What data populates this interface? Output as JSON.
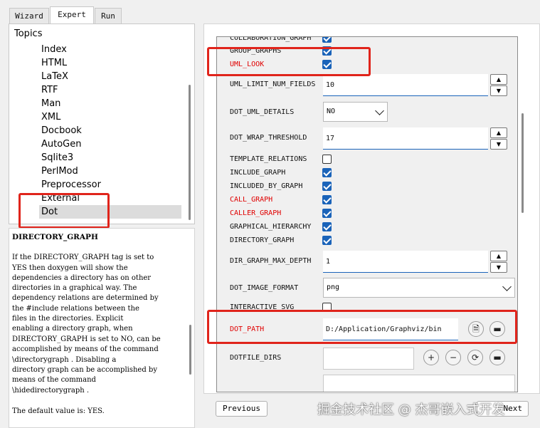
{
  "tabs": [
    {
      "label": "Wizard"
    },
    {
      "label": "Expert"
    },
    {
      "label": "Run"
    }
  ],
  "topics": {
    "title": "Topics",
    "items": [
      "Index",
      "HTML",
      "LaTeX",
      "RTF",
      "Man",
      "XML",
      "Docbook",
      "AutoGen",
      "Sqlite3",
      "PerlMod",
      "Preprocessor",
      "External",
      "Dot"
    ],
    "selected": "Dot"
  },
  "help": {
    "title": "DIRECTORY_GRAPH",
    "lines": [
      "If the DIRECTORY_GRAPH tag is set to",
      "YES then doxygen will show the",
      "dependencies a directory has on other",
      "directories in a graphical way. The",
      "dependency relations are determined by",
      "the #include relations between the",
      "files in the directories. Explicit",
      "enabling a directory graph, when",
      "DIRECTORY_GRAPH is set to NO, can be",
      "accomplished by means of the command",
      "\\directorygraph . Disabling a",
      "directory graph can be accomplished by",
      "means of the command",
      "\\hidedirectorygraph .",
      "",
      "The default value is: YES."
    ]
  },
  "options": {
    "collab": "COLLABORATION_GRAPH",
    "group_graphs": "GROUP_GRAPHS",
    "uml_look": "UML_LOOK",
    "uml_limit": {
      "label": "UML_LIMIT_NUM_FIELDS",
      "value": "10"
    },
    "dot_uml_details": {
      "label": "DOT_UML_DETAILS",
      "value": "NO"
    },
    "dot_wrap": {
      "label": "DOT_WRAP_THRESHOLD",
      "value": "17"
    },
    "template_relations": "TEMPLATE_RELATIONS",
    "include_graph": "INCLUDE_GRAPH",
    "included_by_graph": "INCLUDED_BY_GRAPH",
    "call_graph": "CALL_GRAPH",
    "caller_graph": "CALLER_GRAPH",
    "graphical_hierarchy": "GRAPHICAL_HIERARCHY",
    "directory_graph": "DIRECTORY_GRAPH",
    "dir_graph_depth": {
      "label": "DIR_GRAPH_MAX_DEPTH",
      "value": "1"
    },
    "dot_image_format": {
      "label": "DOT_IMAGE_FORMAT",
      "value": "png"
    },
    "interactive_svg": "INTERACTIVE_SVG",
    "dot_path": {
      "label": "DOT_PATH",
      "value": "D:/Application/Graphviz/bin"
    },
    "dotfile_dirs": "DOTFILE_DIRS"
  },
  "buttons": {
    "previous": "Previous",
    "next": "Next"
  },
  "watermark": "掘金技术社区 @ 杰哥嵌入式开发",
  "colors": {
    "highlight": "#e0241b",
    "checkbox": "#1a63b9",
    "red_label": "#e00000"
  }
}
